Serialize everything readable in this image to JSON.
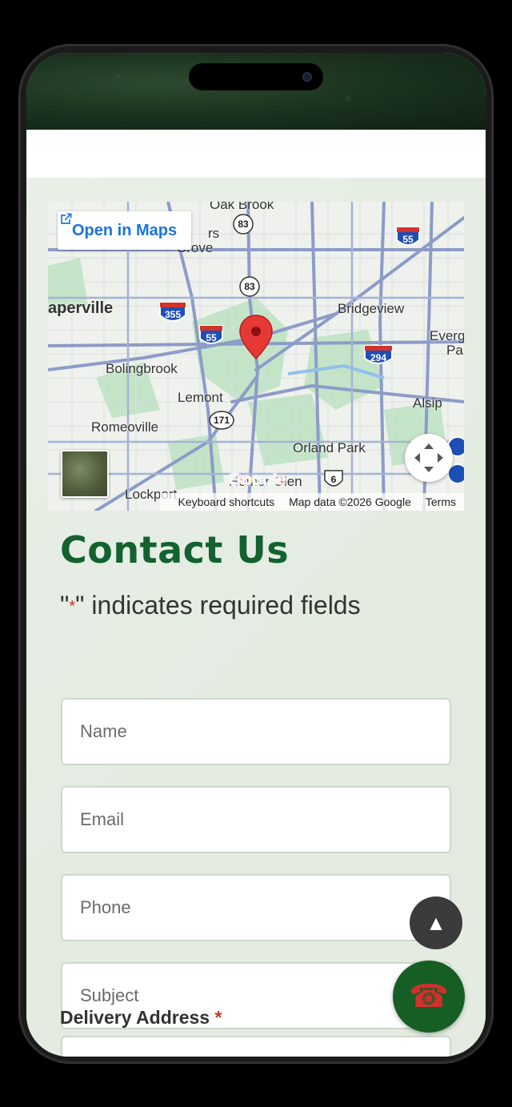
{
  "map": {
    "open_in_maps_label": "Open in Maps",
    "keyboard_shortcuts_label": "Keyboard shortcuts",
    "map_data_label": "Map data ©2026 Google",
    "terms_label": "Terms",
    "google_logo": "Google",
    "places": [
      {
        "name": "Oak Brook"
      },
      {
        "name": "aperville"
      },
      {
        "name": "Bridgeview"
      },
      {
        "name": "Everg"
      },
      {
        "name": "Pa"
      },
      {
        "name": "Bolingbrook"
      },
      {
        "name": "Lemont"
      },
      {
        "name": "Alsip"
      },
      {
        "name": "Romeoville"
      },
      {
        "name": "Orland Park"
      },
      {
        "name": "Lockport"
      },
      {
        "name": "Homer Glen"
      },
      {
        "name": "rs"
      },
      {
        "name": "Grove"
      }
    ],
    "route_shields": [
      "83",
      "83",
      "355",
      "55",
      "55",
      "294",
      "171",
      "6"
    ]
  },
  "contact": {
    "title": "Contact Us",
    "required_note_prefix": "\"",
    "required_star": "*",
    "required_note_suffix": "\" indicates required fields",
    "fields": {
      "name_placeholder": "Name",
      "email_placeholder": "Email",
      "phone_placeholder": "Phone",
      "subject_placeholder": "Subject"
    },
    "delivery_label": "Delivery Address",
    "delivery_star": "*"
  },
  "floating": {
    "scroll_top_icon": "▲",
    "phone_icon": "☎"
  },
  "colors": {
    "accent_green": "#13622f",
    "map_link_blue": "#1a73e8",
    "required_red": "#c0392b",
    "pin_red": "#e53935"
  }
}
